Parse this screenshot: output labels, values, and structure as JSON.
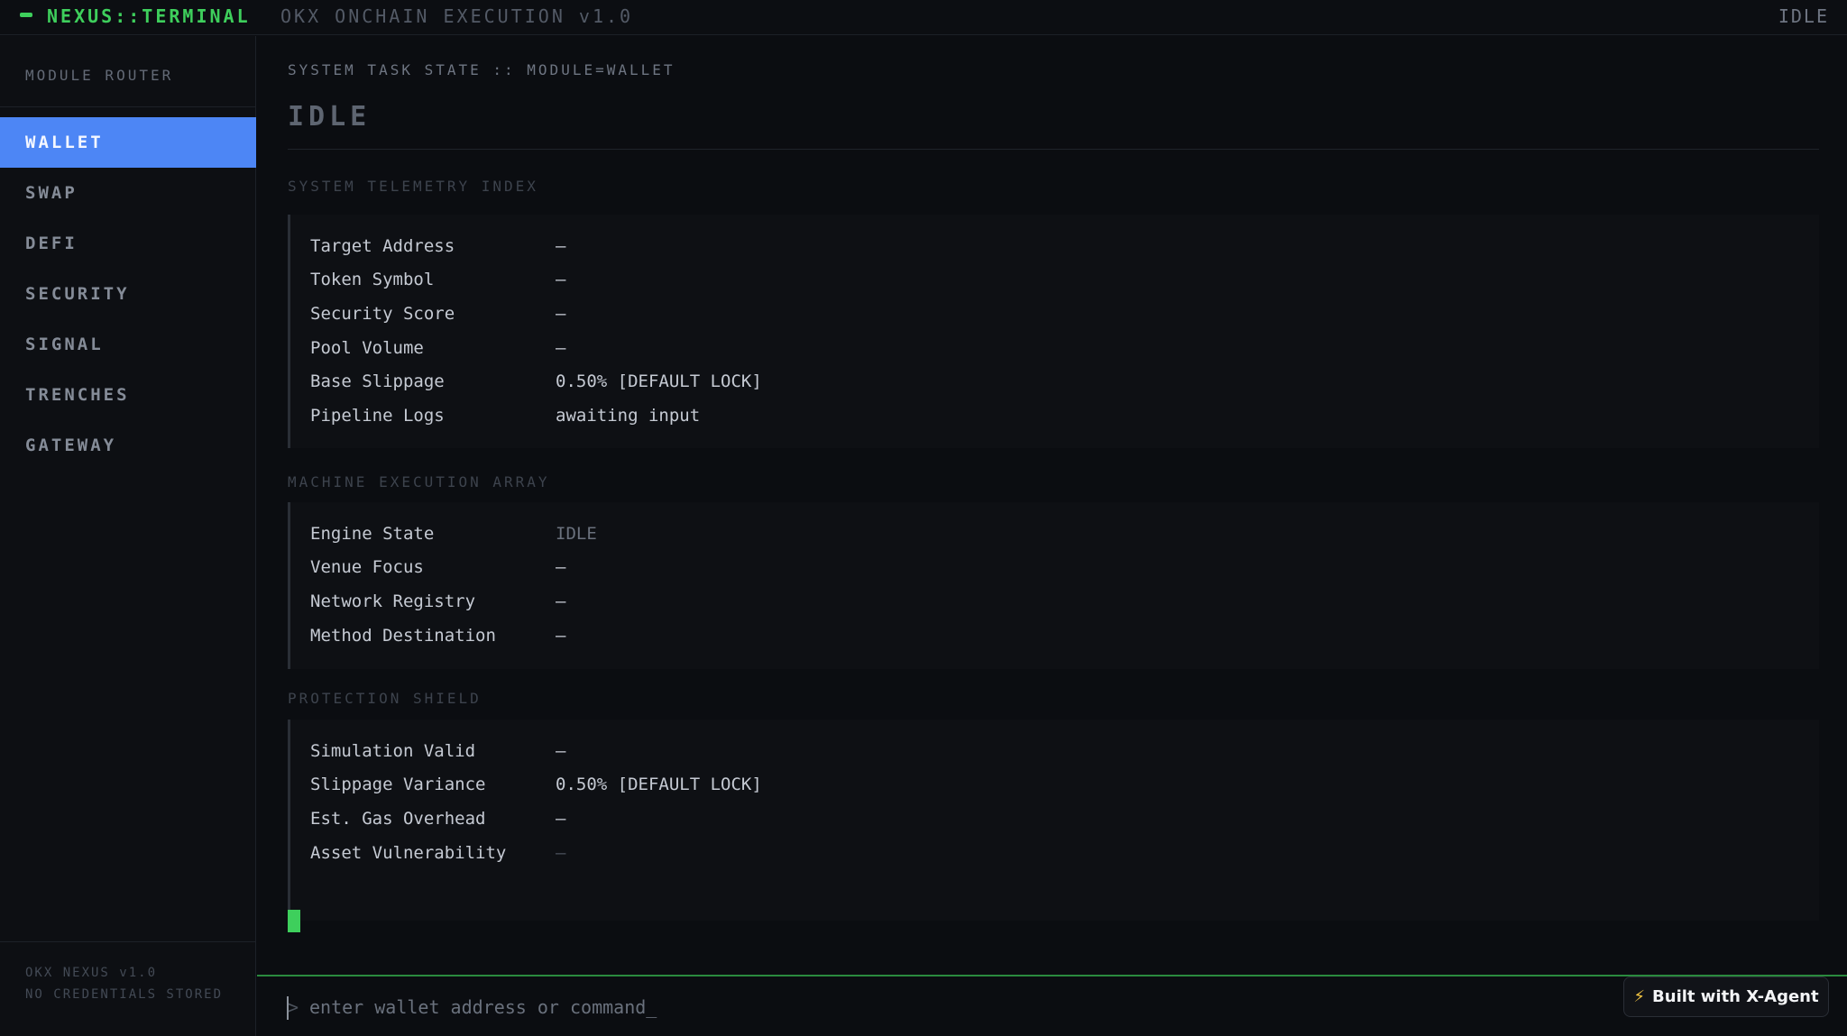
{
  "header": {
    "brand": "NEXUS::TERMINAL",
    "subtitle": "OKX ONCHAIN EXECUTION v1.0",
    "status": "IDLE"
  },
  "sidebar": {
    "heading": "MODULE ROUTER",
    "items": [
      {
        "label": "WALLET",
        "active": true
      },
      {
        "label": "SWAP"
      },
      {
        "label": "DEFI"
      },
      {
        "label": "SECURITY"
      },
      {
        "label": "SIGNAL"
      },
      {
        "label": "TRENCHES"
      },
      {
        "label": "GATEWAY"
      }
    ],
    "footer_line1": "OKX NEXUS v1.0",
    "footer_line2": "NO CREDENTIALS STORED"
  },
  "main": {
    "breadcrumb": "SYSTEM TASK STATE :: MODULE=WALLET",
    "state_title": "IDLE",
    "sections": [
      {
        "label": "SYSTEM TELEMETRY INDEX",
        "rows": [
          {
            "key": "Target Address",
            "value": "—"
          },
          {
            "key": "Token Symbol",
            "value": "—"
          },
          {
            "key": "Security Score",
            "value": "—"
          },
          {
            "key": "Pool Volume",
            "value": "—"
          },
          {
            "key": "Base Slippage",
            "value": "0.50% [DEFAULT LOCK]"
          },
          {
            "key": "Pipeline Logs",
            "value": "awaiting input"
          }
        ]
      },
      {
        "label": "MACHINE EXECUTION ARRAY",
        "rows": [
          {
            "key": "Engine State",
            "value": "IDLE"
          },
          {
            "key": "Venue Focus",
            "value": "—"
          },
          {
            "key": "Network Registry",
            "value": "—"
          },
          {
            "key": "Method Destination",
            "value": "—"
          }
        ]
      },
      {
        "label": "PROTECTION SHIELD",
        "rows": [
          {
            "key": "Simulation Valid",
            "value": "—"
          },
          {
            "key": "Slippage Variance",
            "value": "0.50% [DEFAULT LOCK]"
          },
          {
            "key": "Est. Gas Overhead",
            "value": "—"
          },
          {
            "key": "Asset Vulnerability",
            "value": "—"
          }
        ]
      }
    ]
  },
  "command": {
    "prompt_symbol": ">",
    "placeholder": "enter wallet address or command_",
    "value": ""
  },
  "badge": {
    "label": "Built with X-Agent",
    "icon": "lightning-bolt-icon"
  },
  "colors": {
    "accent_green": "#3ecf5c",
    "active_blue": "#4d86f5",
    "background": "#0b0d11"
  }
}
